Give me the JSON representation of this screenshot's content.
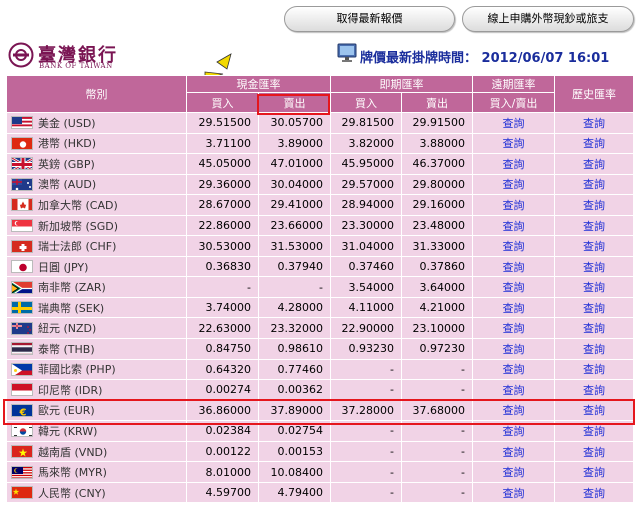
{
  "buttons": {
    "latest_quote": "取得最新報價",
    "online_purchase": "線上申購外幣現鈔或旅支"
  },
  "bank": {
    "name_cn": "臺灣銀行",
    "name_en": "BANK OF TAIWAN"
  },
  "quote_time": {
    "label": "牌價最新掛牌時間：",
    "value": "2012/06/07 16:01"
  },
  "headers": {
    "currency": "幣別",
    "cash_rate": "現金匯率",
    "spot_rate": "即期匯率",
    "forward_rate": "遠期匯率",
    "history_rate": "歷史匯率",
    "buy": "買入",
    "sell": "賣出",
    "forward_sub": "買入/賣出"
  },
  "query_label": "查詢",
  "rows": [
    {
      "name": "美金 (USD)",
      "flag": "us-flag-icon",
      "cash_buy": "29.51500",
      "cash_sell": "30.05700",
      "spot_buy": "29.81500",
      "spot_sell": "29.91500"
    },
    {
      "name": "港幣 (HKD)",
      "flag": "hk-flag-icon",
      "cash_buy": "3.71100",
      "cash_sell": "3.89000",
      "spot_buy": "3.82000",
      "spot_sell": "3.88000"
    },
    {
      "name": "英鎊 (GBP)",
      "flag": "gb-flag-icon",
      "cash_buy": "45.05000",
      "cash_sell": "47.01000",
      "spot_buy": "45.95000",
      "spot_sell": "46.37000"
    },
    {
      "name": "澳幣 (AUD)",
      "flag": "au-flag-icon",
      "cash_buy": "29.36000",
      "cash_sell": "30.04000",
      "spot_buy": "29.57000",
      "spot_sell": "29.80000"
    },
    {
      "name": "加拿大幣 (CAD)",
      "flag": "ca-flag-icon",
      "cash_buy": "28.67000",
      "cash_sell": "29.41000",
      "spot_buy": "28.94000",
      "spot_sell": "29.16000"
    },
    {
      "name": "新加坡幣 (SGD)",
      "flag": "sg-flag-icon",
      "cash_buy": "22.86000",
      "cash_sell": "23.66000",
      "spot_buy": "23.30000",
      "spot_sell": "23.48000"
    },
    {
      "name": "瑞士法郎 (CHF)",
      "flag": "ch-flag-icon",
      "cash_buy": "30.53000",
      "cash_sell": "31.53000",
      "spot_buy": "31.04000",
      "spot_sell": "31.33000"
    },
    {
      "name": "日圓 (JPY)",
      "flag": "jp-flag-icon",
      "cash_buy": "0.36830",
      "cash_sell": "0.37940",
      "spot_buy": "0.37460",
      "spot_sell": "0.37860"
    },
    {
      "name": "南非幣 (ZAR)",
      "flag": "za-flag-icon",
      "cash_buy": "-",
      "cash_sell": "-",
      "spot_buy": "3.54000",
      "spot_sell": "3.64000"
    },
    {
      "name": "瑞典幣 (SEK)",
      "flag": "se-flag-icon",
      "cash_buy": "3.74000",
      "cash_sell": "4.28000",
      "spot_buy": "4.11000",
      "spot_sell": "4.21000"
    },
    {
      "name": "紐元 (NZD)",
      "flag": "nz-flag-icon",
      "cash_buy": "22.63000",
      "cash_sell": "23.32000",
      "spot_buy": "22.90000",
      "spot_sell": "23.10000"
    },
    {
      "name": "泰幣 (THB)",
      "flag": "th-flag-icon",
      "cash_buy": "0.84750",
      "cash_sell": "0.98610",
      "spot_buy": "0.93230",
      "spot_sell": "0.97230"
    },
    {
      "name": "菲國比索 (PHP)",
      "flag": "ph-flag-icon",
      "cash_buy": "0.64320",
      "cash_sell": "0.77460",
      "spot_buy": "-",
      "spot_sell": "-"
    },
    {
      "name": "印尼幣 (IDR)",
      "flag": "id-flag-icon",
      "cash_buy": "0.00274",
      "cash_sell": "0.00362",
      "spot_buy": "-",
      "spot_sell": "-"
    },
    {
      "name": "歐元 (EUR)",
      "flag": "eu-flag-icon",
      "cash_buy": "36.86000",
      "cash_sell": "37.89000",
      "spot_buy": "37.28000",
      "spot_sell": "37.68000"
    },
    {
      "name": "韓元 (KRW)",
      "flag": "kr-flag-icon",
      "cash_buy": "0.02384",
      "cash_sell": "0.02754",
      "spot_buy": "-",
      "spot_sell": "-"
    },
    {
      "name": "越南盾 (VND)",
      "flag": "vn-flag-icon",
      "cash_buy": "0.00122",
      "cash_sell": "0.00153",
      "spot_buy": "-",
      "spot_sell": "-"
    },
    {
      "name": "馬來幣 (MYR)",
      "flag": "my-flag-icon",
      "cash_buy": "8.01000",
      "cash_sell": "10.08400",
      "spot_buy": "-",
      "spot_sell": "-"
    },
    {
      "name": "人民幣 (CNY)",
      "flag": "cn-flag-icon",
      "cash_buy": "4.59700",
      "cash_sell": "4.79400",
      "spot_buy": "-",
      "spot_sell": "-"
    }
  ],
  "colors": {
    "header_bg": "#c0679a",
    "row_bg": "#f1d3e6",
    "link": "#1d2dd6",
    "highlight": "#e5161d",
    "brand": "#7a1553",
    "quote_time": "#1a2d9c"
  }
}
